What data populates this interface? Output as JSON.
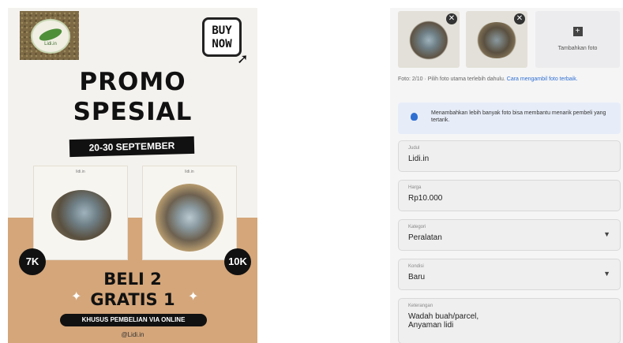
{
  "poster": {
    "logo_text": "Lidi.in",
    "buy_now_line1": "BUY",
    "buy_now_line2": "NOW",
    "title_line1": "PROMO",
    "title_line2": "SPESIAL",
    "date_range": "20-30 SEPTEMBER",
    "product_left": {
      "tag": "lidi.in",
      "price": "7K"
    },
    "product_right": {
      "tag": "lidi.in",
      "price": "10K"
    },
    "offer_line1": "BELI 2",
    "offer_line2": "GRATIS 1",
    "online_note": "KHUSUS PEMBELIAN VIA ONLINE",
    "handle": "@Lidi.in",
    "colors": {
      "background": "#f4f2ee",
      "band": "#d4a67a",
      "ink": "#111111"
    }
  },
  "form": {
    "add_photo_label": "Tambahkan foto",
    "photo_note": "Foto: 2/10 · Pilih foto utama terlebih dahulu.",
    "photo_note_link": "Cara mengambil foto terbaik.",
    "tip_text": "Menambahkan lebih banyak foto bisa membantu menarik pembeli yang tertarik.",
    "fields": {
      "title": {
        "label": "Judul",
        "value": "Lidi.in"
      },
      "price": {
        "label": "Harga",
        "value": "Rp10.000"
      },
      "category": {
        "label": "Kategori",
        "value": "Peralatan"
      },
      "condition": {
        "label": "Kondisi",
        "value": "Baru"
      },
      "description": {
        "label": "Keterangan",
        "value_line1": "Wadah buah/parcel,",
        "value_line2": "Anyaman lidi"
      }
    },
    "icons": {
      "remove_photo": "close-icon",
      "add_photo": "add-photo-icon",
      "tip": "lightbulb-icon",
      "dropdown": "chevron-down-icon"
    },
    "colors": {
      "link": "#2f6fd1",
      "tip_bg": "#e7edf8"
    }
  }
}
